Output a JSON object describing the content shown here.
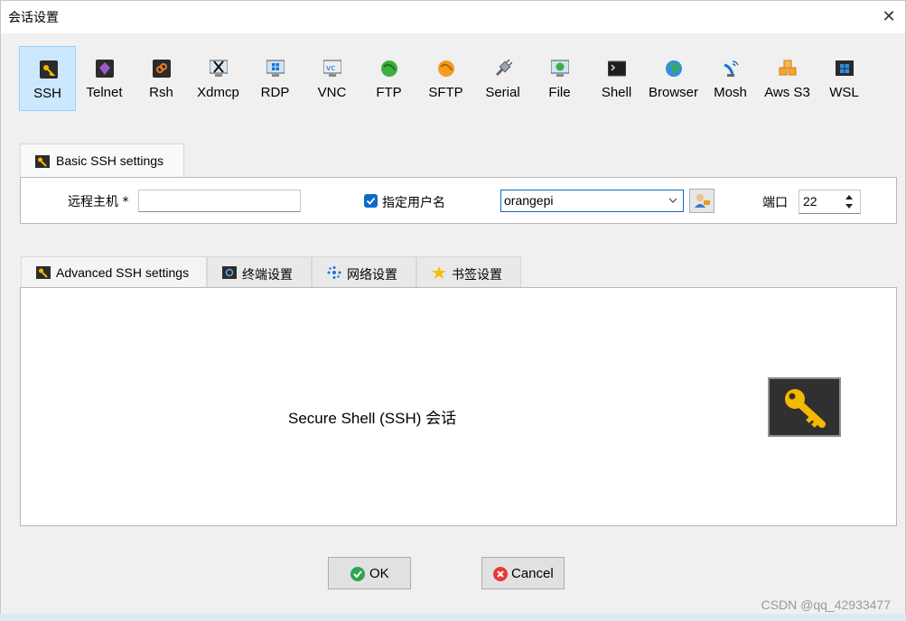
{
  "window": {
    "title": "会话设置"
  },
  "session_types": [
    {
      "label": "SSH",
      "icon": "ssh-key-icon",
      "active": true
    },
    {
      "label": "Telnet",
      "icon": "telnet-icon"
    },
    {
      "label": "Rsh",
      "icon": "rsh-icon"
    },
    {
      "label": "Xdmcp",
      "icon": "xdmcp-icon"
    },
    {
      "label": "RDP",
      "icon": "rdp-icon"
    },
    {
      "label": "VNC",
      "icon": "vnc-icon"
    },
    {
      "label": "FTP",
      "icon": "ftp-globe-icon"
    },
    {
      "label": "SFTP",
      "icon": "sftp-globe-icon"
    },
    {
      "label": "Serial",
      "icon": "serial-plug-icon"
    },
    {
      "label": "File",
      "icon": "file-monitor-icon"
    },
    {
      "label": "Shell",
      "icon": "shell-terminal-icon"
    },
    {
      "label": "Browser",
      "icon": "browser-globe-icon"
    },
    {
      "label": "Mosh",
      "icon": "mosh-satellite-icon"
    },
    {
      "label": "Aws S3",
      "icon": "aws-s3-cubes-icon"
    },
    {
      "label": "WSL",
      "icon": "wsl-windows-icon"
    }
  ],
  "basic": {
    "tab_label": "Basic SSH settings",
    "remote_host_label": "远程主机 *",
    "remote_host_value": "",
    "specify_username_label": "指定用户名",
    "specify_username_checked": true,
    "username_value": "orangepi",
    "port_label": "端口",
    "port_value": "22"
  },
  "advanced_tabs": [
    {
      "label": "Advanced SSH settings",
      "icon": "ssh-key-icon"
    },
    {
      "label": "终端设置",
      "icon": "terminal-settings-icon"
    },
    {
      "label": "网络设置",
      "icon": "network-icon"
    },
    {
      "label": "书签设置",
      "icon": "star-icon"
    }
  ],
  "panel": {
    "description": "Secure Shell (SSH) 会话"
  },
  "buttons": {
    "ok_label": "OK",
    "cancel_label": "Cancel"
  },
  "watermark": "CSDN @qq_42933477",
  "colors": {
    "accent": "#0f6bc7",
    "active_tab_bg": "#cce8ff",
    "key_gold": "#f5b800"
  }
}
